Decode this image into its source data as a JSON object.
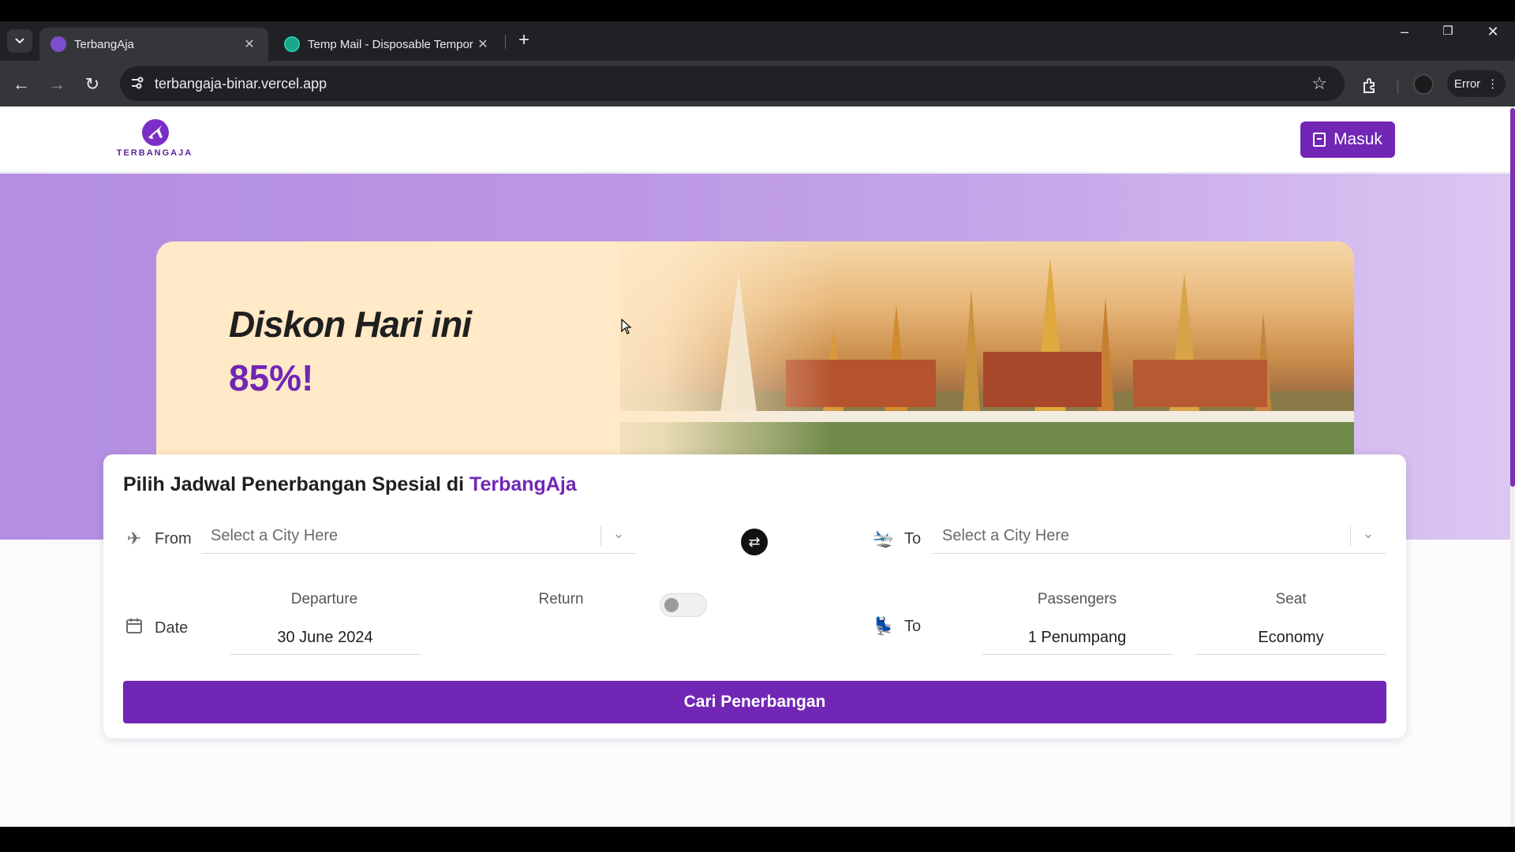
{
  "browser": {
    "tabs": [
      {
        "title": "TerbangAja",
        "active": true
      },
      {
        "title": "Temp Mail - Disposable Tempor",
        "active": false
      }
    ],
    "url": "terbangaja-binar.vercel.app",
    "status_chip": "Error"
  },
  "site": {
    "logo_text": "TERBANGAJA",
    "login_button": "Masuk"
  },
  "banner": {
    "title": "Diskon Hari ini",
    "discount": "85%!"
  },
  "search": {
    "title_prefix": "Pilih Jadwal Penerbangan Spesial di ",
    "title_brand": "TerbangAja",
    "from_label": "From",
    "from_placeholder": "Select a City Here",
    "to_label": "To",
    "to_placeholder": "Select a City Here",
    "date_label": "Date",
    "departure_label": "Departure",
    "departure_value": "30 June 2024",
    "return_label": "Return",
    "return_enabled": false,
    "passenger_row_label": "To",
    "passengers_label": "Passengers",
    "passengers_value": "1 Penumpang",
    "seat_label": "Seat",
    "seat_value": "Economy",
    "submit_label": "Cari Penerbangan"
  },
  "colors": {
    "brand": "#7126b5",
    "hero": "#b38ee2"
  }
}
